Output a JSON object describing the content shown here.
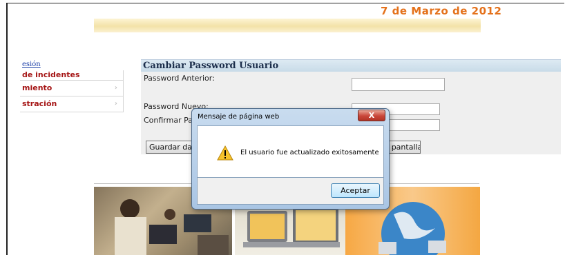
{
  "header": {
    "date": "7 de Marzo de 2012"
  },
  "sidebar": {
    "session_link": "esión",
    "items": [
      {
        "label": "de incidentes"
      },
      {
        "label": "miento",
        "arrow": "›"
      },
      {
        "label": "stración",
        "arrow": "›"
      }
    ]
  },
  "panel": {
    "title": "Cambiar Password Usuario",
    "old_password_label": "Password Anterior:",
    "new_password_label": "Password Nuevo:",
    "confirm_password_label": "Confirmar Password:",
    "save_button": "Guardar datos",
    "clear_button": "Limpiar pantalla"
  },
  "dialog": {
    "title": "Mensaje de página web",
    "close_label": "X",
    "message": "El usuario fue actualizado exitosamente",
    "ok_button": "Aceptar",
    "icon": "warning-icon"
  },
  "colors": {
    "date": "#e4711b",
    "menu_text": "#a51515",
    "link": "#1c3fa8"
  }
}
